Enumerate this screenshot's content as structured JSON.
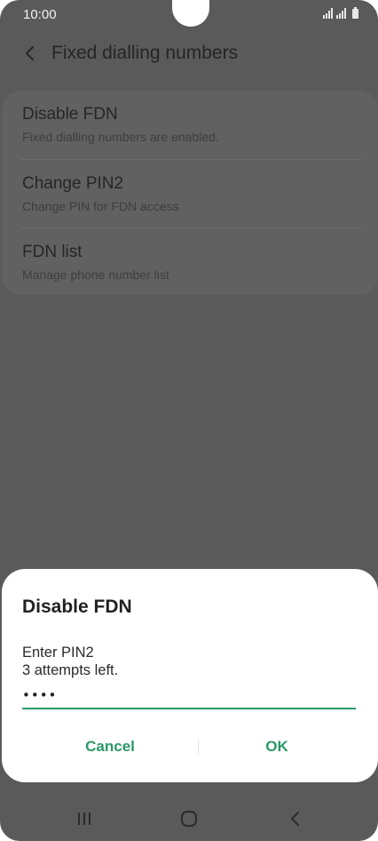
{
  "status_bar": {
    "time": "10:00"
  },
  "app_bar": {
    "title": "Fixed dialling numbers",
    "back_icon": "chevron-left-icon"
  },
  "settings": {
    "items": [
      {
        "title": "Disable FDN",
        "subtitle": "Fixed dialling numbers are enabled."
      },
      {
        "title": "Change PIN2",
        "subtitle": "Change PIN for FDN access"
      },
      {
        "title": "FDN list",
        "subtitle": "Manage phone number list"
      }
    ]
  },
  "dialog": {
    "title": "Disable FDN",
    "message_line1": "Enter PIN2",
    "message_line2": "3 attempts left.",
    "pin_value": "••••",
    "cancel_label": "Cancel",
    "ok_label": "OK"
  },
  "navigation": {
    "icons": [
      "recents-icon",
      "home-icon",
      "back-icon"
    ]
  },
  "colors": {
    "accent": "#2a9966",
    "scrim": "#5a5a5a",
    "dialog_bg": "#ffffff"
  }
}
